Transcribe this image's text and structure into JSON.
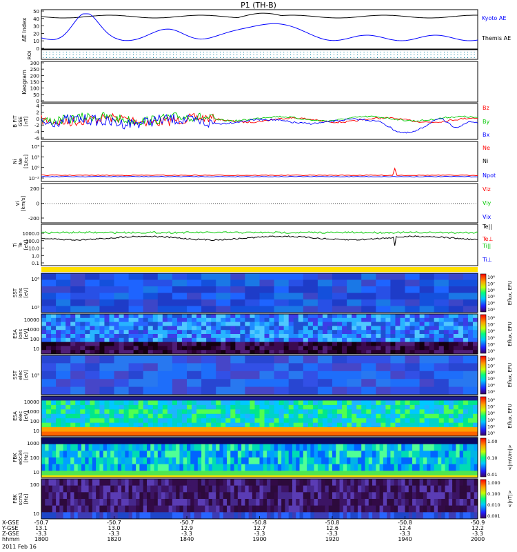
{
  "title": "P1 (TH-B)",
  "colors": {
    "kyoto": "#000000",
    "themis": "#0000ff",
    "bx": "#0000ff",
    "by": "#00c800",
    "bz": "#ff0000",
    "te_par": "#000000",
    "te_perp": "#ff0000",
    "ti_par": "#00c800",
    "ti_perp": "#0000ff",
    "strip": "#ffe000"
  },
  "time_axis": {
    "ticks": [
      "1800",
      "1820",
      "1840",
      "1900",
      "1920",
      "1940",
      "2000"
    ],
    "rows": [
      {
        "label": "X-GSE",
        "values": [
          "-50.7",
          "-50.7",
          "-50.7",
          "-50.8",
          "-50.8",
          "-50.8",
          "-50.9"
        ]
      },
      {
        "label": "Y-GSE",
        "values": [
          "13.1",
          "13.0",
          "12.9",
          "12.7",
          "12.6",
          "12.4",
          "12.2"
        ]
      },
      {
        "label": "Z-GSE",
        "values": [
          "-3.3",
          "-3.3",
          "-3.3",
          "-3.3",
          "-3.3",
          "-3.3",
          "-3.3"
        ]
      },
      {
        "label": "hhmm",
        "values": [
          "1800",
          "1820",
          "1840",
          "1900",
          "1920",
          "1940",
          "2000"
        ]
      }
    ],
    "date": "2011 Feb 16"
  },
  "panels": {
    "ae": {
      "ylabel": "AE Index",
      "ticks": [
        "50",
        "40",
        "30",
        "20",
        "10",
        "0"
      ],
      "legend": [
        "Kyoto AE",
        "Themis AE"
      ]
    },
    "roi": {
      "ylabel": "ROI"
    },
    "keogram": {
      "ylabel": "Keogram",
      "ticks": [
        "300",
        "250",
        "200",
        "150",
        "100",
        "50",
        "0"
      ]
    },
    "bfield": {
      "ylabel_lines": [
        "B FIT",
        "GSE",
        "[nT]"
      ],
      "ticks": [
        "4",
        "2",
        "0",
        "-2",
        "-4",
        "-6"
      ],
      "legend": [
        "Bz",
        "By",
        "Bx"
      ]
    },
    "density": {
      "ylabel_lines": [
        "Ni",
        "Ne",
        "[1/cc]"
      ],
      "ticks": [
        "10⁴",
        "10²",
        "10⁰",
        "10⁻²"
      ],
      "legend": [
        "Ne",
        "Ni",
        "Npot"
      ]
    },
    "velocity": {
      "ylabel_lines": [
        "Vi",
        "[km/s]"
      ],
      "ticks": [
        "200",
        "0",
        "-200"
      ],
      "legend": [
        "Viz",
        "Viy",
        "Vix"
      ]
    },
    "temp": {
      "ylabel_lines": [
        "Ti",
        "Te",
        "[eV]"
      ],
      "ticks": [
        "1000.0",
        "100.0",
        "10.0",
        "1.0",
        "0.1"
      ],
      "legend": [
        "Te||",
        "Te⊥",
        "Ti||",
        "Ti⊥"
      ]
    },
    "sst_i": {
      "ylabel_lines": [
        "SST",
        "ions",
        "[eV]"
      ],
      "ticks": [
        "10⁶",
        "10⁵"
      ],
      "cbar": [
        "10⁸",
        "10⁷",
        "10⁶",
        "10⁵",
        "10⁴",
        "10³"
      ],
      "cbar_label": "Eflux, EFU"
    },
    "esa_i": {
      "ylabel_lines": [
        "ESA",
        "ions",
        "[eV]"
      ],
      "ticks": [
        "10000",
        "1000",
        "100",
        "10"
      ],
      "cbar": [
        "10⁸",
        "10⁷",
        "10⁶",
        "10⁵",
        "10⁴",
        "10³"
      ],
      "cbar_label": "Eflux, EFU"
    },
    "sst_e": {
      "ylabel_lines": [
        "SST",
        "elec",
        "[eV]"
      ],
      "ticks": [
        "10⁵"
      ],
      "cbar": [
        "10⁸",
        "10⁷",
        "10⁶",
        "10⁵",
        "10⁴",
        "10³"
      ],
      "cbar_label": "Eflux, EFU"
    },
    "esa_e": {
      "ylabel_lines": [
        "ESA",
        "elec",
        "[eV]"
      ],
      "ticks": [
        "10000",
        "1000",
        "100",
        "10"
      ],
      "cbar": [
        "10⁸",
        "10⁷",
        "10⁶",
        "10⁵",
        "10⁴",
        "10³"
      ],
      "cbar_label": "Eflux, EFU"
    },
    "fbk1": {
      "ylabel_lines": [
        "FBK",
        "edc34",
        "[Hz]"
      ],
      "ticks": [
        "1000",
        "100",
        "10"
      ],
      "cbar": [
        "1.00",
        "0.10",
        "0.01"
      ],
      "cbar_label": "<|mV/m|>"
    },
    "fbk2": {
      "ylabel_lines": [
        "FBK",
        "scm1",
        "[Hz]"
      ],
      "ticks": [
        "100",
        "10"
      ],
      "cbar": [
        "1.000",
        "0.100",
        "0.010",
        "0.001"
      ],
      "cbar_label": "<|nT|>"
    }
  }
}
